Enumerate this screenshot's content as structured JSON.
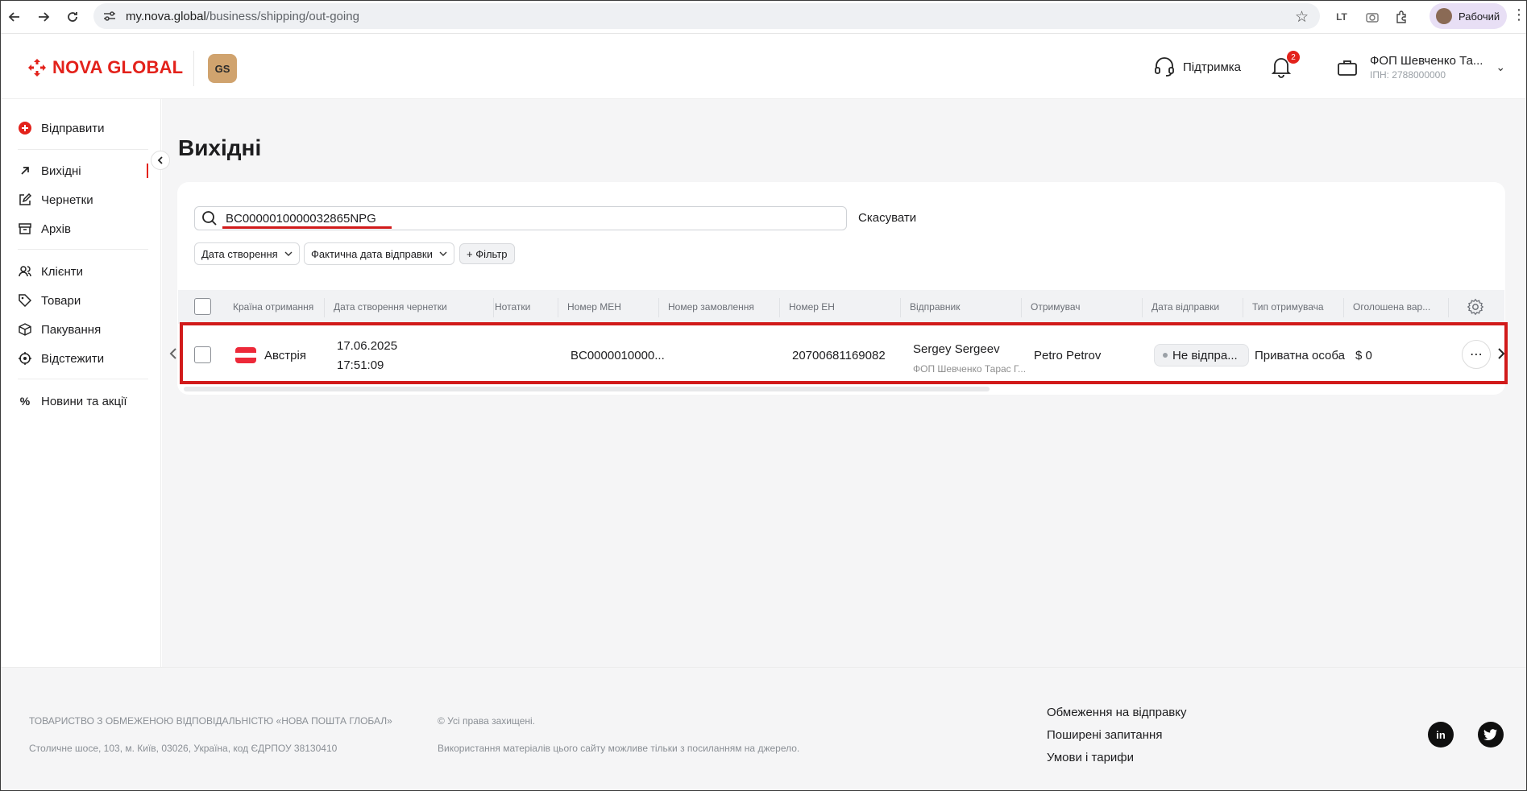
{
  "browser": {
    "url_host": "my.nova.global",
    "url_path": "/business/shipping/out-going",
    "profile_label": "Рабочий"
  },
  "header": {
    "logo_text": "NOVA GLOBAL",
    "gs_badge": "GS",
    "support_label": "Підтримка",
    "notification_count": "2",
    "account_name": "ФОП Шевченко Та...",
    "account_inn": "ІПН: 2788000000"
  },
  "sidebar": {
    "send": "Відправити",
    "items": [
      {
        "label": "Вихідні",
        "icon": "arrow-up-right-icon"
      },
      {
        "label": "Чернетки",
        "icon": "edit-icon"
      },
      {
        "label": "Архів",
        "icon": "archive-icon"
      },
      {
        "label": "Клієнти",
        "icon": "clients-icon"
      },
      {
        "label": "Товари",
        "icon": "tag-icon"
      },
      {
        "label": "Пакування",
        "icon": "package-icon"
      },
      {
        "label": "Відстежити",
        "icon": "track-icon"
      },
      {
        "label": "Новини та акції",
        "icon": "percent-icon"
      }
    ]
  },
  "main": {
    "title": "Вихідні",
    "search_value": "BC0000010000032865NPG",
    "cancel_label": "Скасувати",
    "filters": [
      "Дата створення",
      "Фактична дата відправки",
      "+ Фільтр"
    ],
    "columns": [
      "Країна отримання",
      "Дата створення чернетки",
      "Нотатки",
      "Номер МЕН",
      "Номер замовлення",
      "Номер ЕН",
      "Відправник",
      "Отримувач",
      "Дата відправки",
      "Тип отримувача",
      "Оголошена вар..."
    ],
    "row": {
      "country": "Австрія",
      "created_date": "17.06.2025",
      "created_time": "17:51:09",
      "men_number": "BC0000010000...",
      "en_number": "20700681169082",
      "sender_name": "Sergey Sergeev",
      "sender_company": "ФОП Шевченко Тарас Г...",
      "recipient": "Petro Petrov",
      "status": "Не відпра...",
      "recipient_type": "Приватна особа",
      "declared_value": "$ 0"
    },
    "flag_colors": [
      "#ed2939",
      "#ffffff",
      "#ed2939"
    ]
  },
  "footer": {
    "company": "ТОВАРИСТВО З ОБМЕЖЕНОЮ ВІДПОВІДАЛЬНІСТЮ «НОВА ПОШТА ГЛОБАЛ»",
    "address": "Столичне шосе, 103, м. Київ, 03026, Україна, код ЄДРПОУ 38130410",
    "rights": "© Усі права захищені.",
    "usage": "Використання матеріалів цього сайту можливе тільки з посиланням на джерело.",
    "links": [
      "Обмеження на відправку",
      "Поширені запитання",
      "Умови і тарифи"
    ],
    "social_linkedin": "in"
  },
  "colors": {
    "brand": "#e3221b",
    "highlight": "#d11a1a"
  }
}
